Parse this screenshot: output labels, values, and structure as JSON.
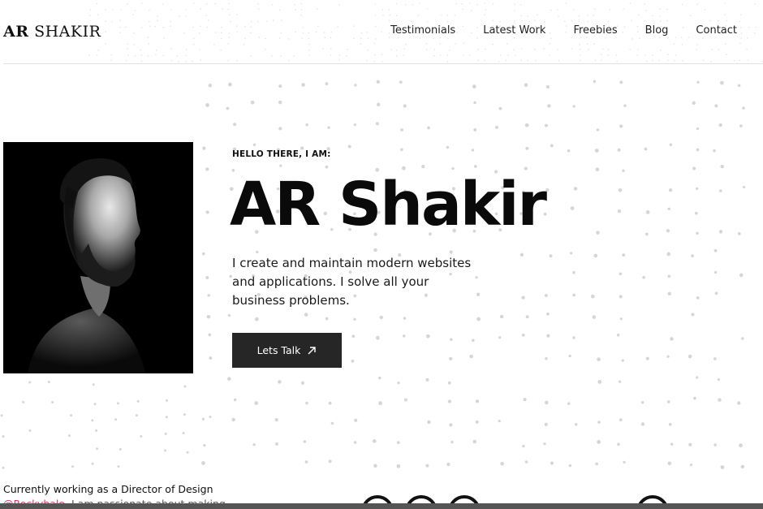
{
  "header": {
    "logo_bold": "AR",
    "logo_light": "SHAKIR",
    "nav": [
      "Testimonials",
      "Latest Work",
      "Freebies",
      "Blog",
      "Contact"
    ]
  },
  "hero": {
    "eyebrow": "HELLO THERE, I AM:",
    "name": "AR Shakir",
    "description": "I create and maintain modern websites and applications. I solve all your business problems.",
    "cta_label": "Lets Talk",
    "cta_icon": "arrow-up-right-icon",
    "portrait_icon": "portrait-photo"
  },
  "about": {
    "line1": "Currently working as a Director of Design",
    "handle": "@Rockybalo",
    "line2_rest": ", I am passionate about making sure"
  },
  "colors": {
    "accent": "#e2336b",
    "button_bg": "#262626",
    "text": "#111111",
    "dots": "#d6d6d6"
  }
}
